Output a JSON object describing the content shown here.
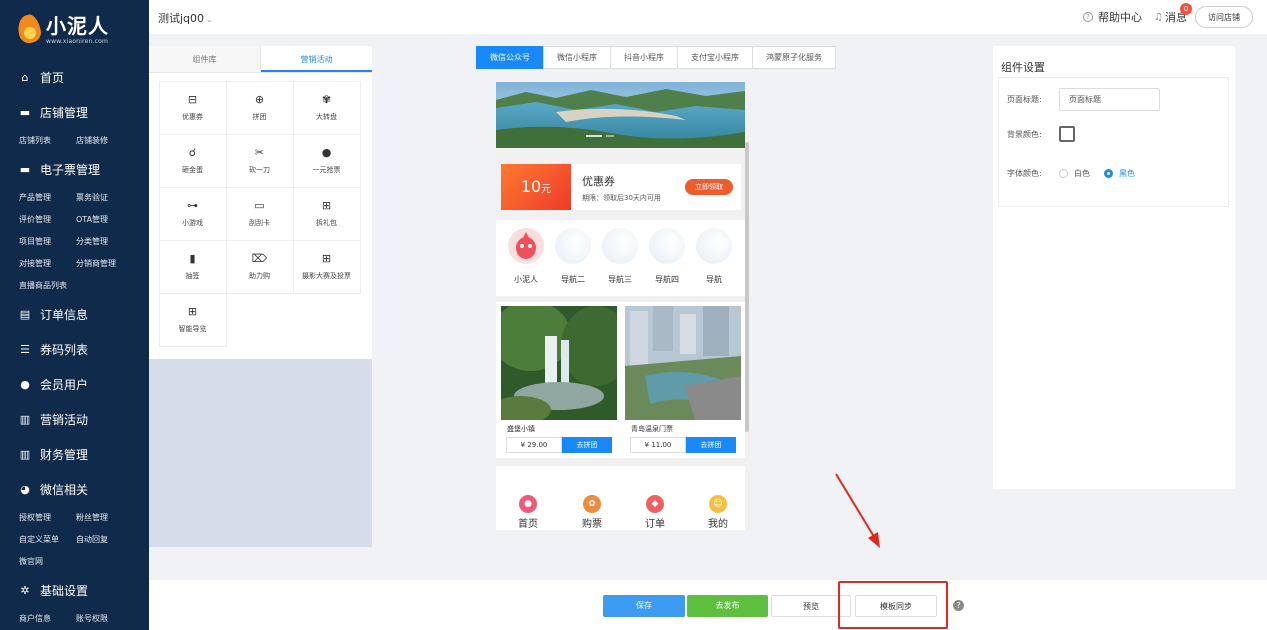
{
  "brand": {
    "name": "小泥人",
    "url": "www.xiaoniren.com"
  },
  "sidebar": {
    "home": "首页",
    "store_mgmt": "店铺管理",
    "store_sub": [
      "店铺列表",
      "店铺装修"
    ],
    "eticket_mgmt": "电子票管理",
    "eticket_sub": [
      "产品管理",
      "票务验证",
      "评价管理",
      "OTA管理",
      "项目管理",
      "分类管理",
      "对接管理",
      "分销商管理",
      "直播商品列表"
    ],
    "order_info": "订单信息",
    "code_list": "券码列表",
    "members": "会员用户",
    "marketing": "营销活动",
    "finance": "财务管理",
    "wechat": "微信相关",
    "wechat_sub": [
      "授权管理",
      "粉丝管理",
      "自定义菜单",
      "自动回复",
      "微官网"
    ],
    "basic_settings": "基础设置",
    "basic_sub": [
      "商户信息",
      "账号权限"
    ]
  },
  "topbar": {
    "store_name": "测试jq00",
    "help": "帮助中心",
    "messages": "消息",
    "message_badge": "0",
    "visit_store": "访问店铺"
  },
  "left_panel": {
    "tabs": [
      "组件库",
      "营销活动"
    ],
    "items": [
      {
        "label": "优惠券",
        "icon": "ticket-icon"
      },
      {
        "label": "拼团",
        "icon": "bag-icon"
      },
      {
        "label": "大转盘",
        "icon": "wheel-icon"
      },
      {
        "label": "砸金蛋",
        "icon": "hammer-icon"
      },
      {
        "label": "砍一刀",
        "icon": "scissors-icon"
      },
      {
        "label": "一元抢票",
        "icon": "coin-icon"
      },
      {
        "label": "小游戏",
        "icon": "gamepad-icon"
      },
      {
        "label": "刮刮卡",
        "icon": "card-icon"
      },
      {
        "label": "拆礼包",
        "icon": "gift-icon"
      },
      {
        "label": "抽签",
        "icon": "lot-icon"
      },
      {
        "label": "助力购",
        "icon": "rocket-icon"
      },
      {
        "label": "摄影大赛及投票",
        "icon": "gift-icon"
      },
      {
        "label": "智能导览",
        "icon": "gift-icon"
      }
    ]
  },
  "channels": [
    "微信公众号",
    "微信小程序",
    "抖音小程序",
    "支付宝小程序",
    "鸿蒙原子化服务"
  ],
  "preview": {
    "coupon": {
      "amount": "10",
      "unit": "元",
      "title": "优惠券",
      "desc": "期限：领取后30天内可用",
      "button": "立即领取"
    },
    "nav": [
      "小泥人",
      "导航二",
      "导航三",
      "导航四",
      "导航"
    ],
    "products": [
      {
        "name": "盛堡小镇",
        "price": "¥ 29.00",
        "button": "去拼团"
      },
      {
        "name": "青岛温泉门票",
        "price": "¥ 11.00",
        "button": "去拼团"
      }
    ],
    "tabbar": [
      "首页",
      "购票",
      "订单",
      "我的"
    ]
  },
  "settings": {
    "title": "组件设置",
    "page_title_label": "页面标题:",
    "page_title_value": "页面标题",
    "bg_color_label": "背景颜色:",
    "font_color_label": "字体颜色:",
    "font_options": [
      "白色",
      "黑色"
    ],
    "font_selected": "黑色"
  },
  "bottom": {
    "save": "保存",
    "publish": "去发布",
    "preview": "预览",
    "sync": "模板同步",
    "help": "?"
  },
  "colors": {
    "sidebar": "#0f2a4a",
    "primary": "#1989fa",
    "publish": "#5fbf3f",
    "highlight": "#e0291f",
    "coupon": "#ef5b2c"
  }
}
